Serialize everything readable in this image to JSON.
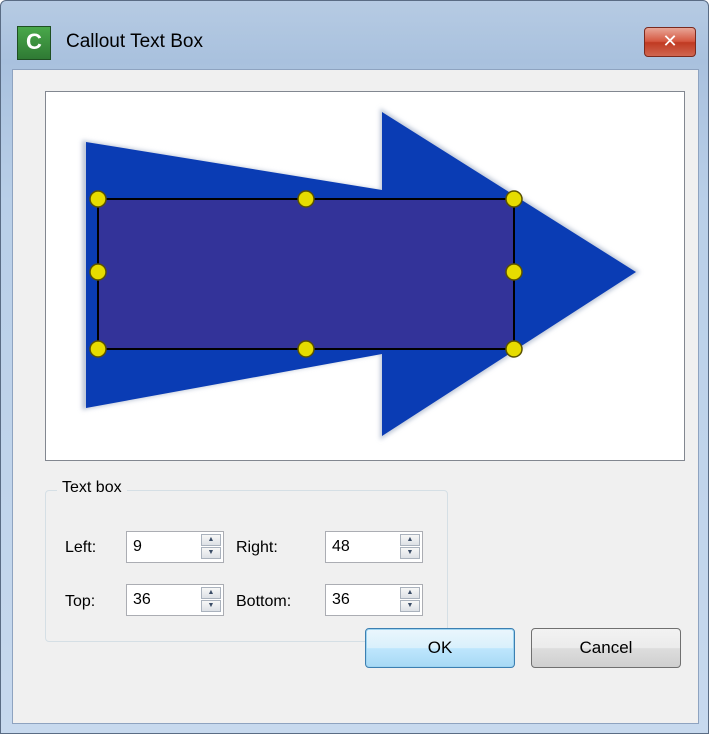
{
  "window": {
    "title": "Callout Text Box",
    "app_icon_letter": "C",
    "close_glyph": "✕"
  },
  "preview": {
    "arrow_color": "#0a3cb4",
    "text_box_color": "#333399",
    "handle_color": "#e6dc00"
  },
  "text_box_group": {
    "legend": "Text box",
    "left": {
      "label": "Left:",
      "value": "9"
    },
    "right": {
      "label": "Right:",
      "value": "48"
    },
    "top": {
      "label": "Top:",
      "value": "36"
    },
    "bottom": {
      "label": "Bottom:",
      "value": "36"
    },
    "spin_up_glyph": "▲",
    "spin_down_glyph": "▼"
  },
  "buttons": {
    "ok": "OK",
    "cancel": "Cancel"
  }
}
